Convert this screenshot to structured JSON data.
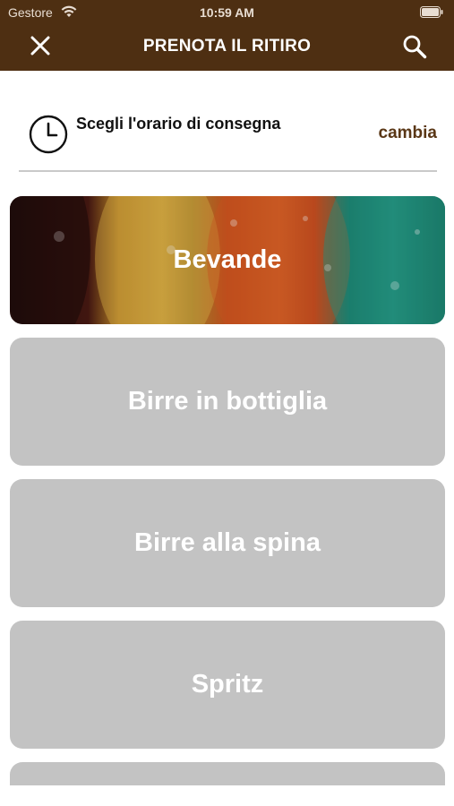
{
  "status_bar": {
    "carrier": "Gestore",
    "time": "10:59 AM",
    "wifi_icon": "wifi-icon",
    "battery_icon": "battery-icon"
  },
  "header": {
    "title": "PRENOTA IL RITIRO",
    "close_icon": "close-icon",
    "search_icon": "search-icon",
    "background_color": "#4e2f12"
  },
  "delivery": {
    "icon": "clock-icon",
    "label": "Scegli l'orario di consegna",
    "change_link": "cambia",
    "link_color": "#5a3716"
  },
  "categories": [
    {
      "label": "Bevande",
      "style": "photo"
    },
    {
      "label": "Birre in bottiglia",
      "style": "plain"
    },
    {
      "label": "Birre alla spina",
      "style": "plain"
    },
    {
      "label": "Spritz",
      "style": "plain"
    }
  ],
  "colors": {
    "card_gray": "#c3c3c3",
    "card_text": "#ffffff"
  }
}
